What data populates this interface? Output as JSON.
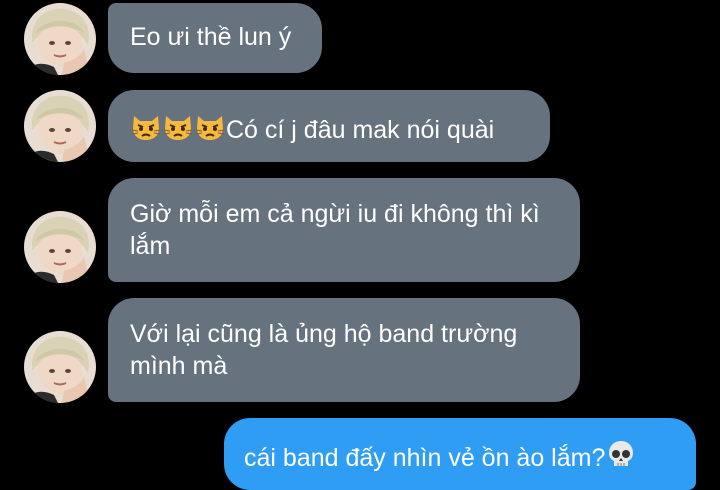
{
  "chat": {
    "colors": {
      "background": "#000000",
      "incoming_bubble": "#66727e",
      "outgoing_bubble": "#2f9df3",
      "text": "#ffffff"
    },
    "messages": [
      {
        "sender": "contact",
        "text": "Eo ưi thề lun ý"
      },
      {
        "sender": "contact",
        "emoji_prefix": [
          "pouting-cat-icon",
          "pouting-cat-icon",
          "pouting-cat-icon"
        ],
        "text": "Có cí j đâu mak nói quài"
      },
      {
        "sender": "contact",
        "text": "Giờ mỗi em cả ngừi iu đi không thì kì lắm"
      },
      {
        "sender": "contact",
        "text": "Với lại cũng là ủng hộ band trường mình mà"
      },
      {
        "sender": "me",
        "text": "cái band đấy nhìn vẻ ồn ào lắm?",
        "emoji_suffix": "skull-icon"
      }
    ]
  }
}
